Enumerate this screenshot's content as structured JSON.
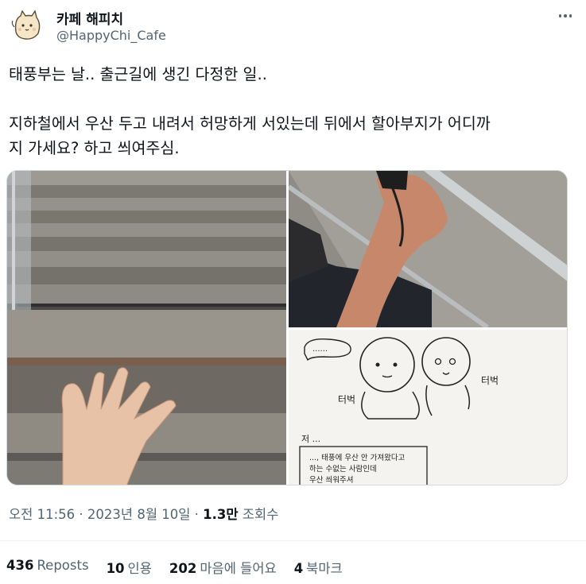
{
  "author": {
    "display_name": "카페 해피치",
    "handle": "@HappyChi_Cafe",
    "avatar_icon": "cat-avatar-icon"
  },
  "more_icon": "more-horizontal-icon",
  "tweet": {
    "text": "태풍부는 날.. 출근길에 생긴 다정한 일..\n\n지하철에서 우산 두고 내려서 허망하게 서있는데 뒤에서 할아부지가 어디까\n지 가세요? 하고 씌여주심."
  },
  "media": {
    "drawing_captions": {
      "speech": "......",
      "left_label": "터벅",
      "right_label": "터벅",
      "note_header": "저 ...",
      "note_lines": [
        "..., 태풍에 우산 안 가져왔다고",
        "하는 수없는 사람인데",
        "우산 씌워주셔"
      ]
    }
  },
  "meta": {
    "time": "오전 11:56",
    "sep": "·",
    "date": "2023년 8월 10일",
    "views_count": "1.3만",
    "views_label": "조회수"
  },
  "stats": [
    {
      "count": "436",
      "label": "Reposts"
    },
    {
      "count": "10",
      "label": "인용"
    },
    {
      "count": "202",
      "label": "마음에 들어요"
    },
    {
      "count": "4",
      "label": "북마크"
    }
  ]
}
